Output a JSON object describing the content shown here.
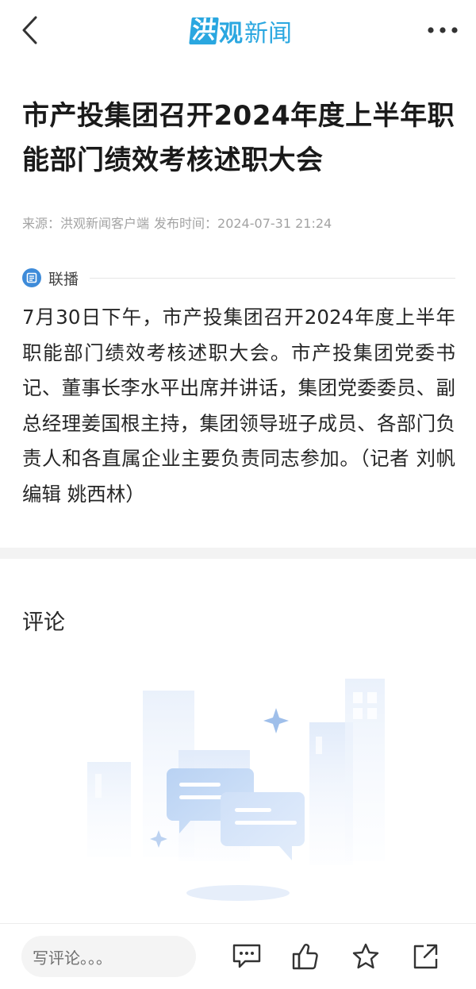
{
  "nav": {
    "logo_part1": "洪",
    "logo_part2": "观",
    "logo_part3": "新闻"
  },
  "article": {
    "title": "市产投集团召开2024年度上半年职能部门绩效考核述职大会",
    "source": "来源：洪观新闻客户端",
    "published": "发布时间：2024-07-31 21:24",
    "section_label": "联播",
    "body": "7月30日下午，市产投集团召开2024年度上半年职能部门绩效考核述职大会。市产投集团党委书记、董事长李水平出席并讲话，集团党委委员、副总经理姜国根主持，集团领导班子成员、各部门负责人和各直属企业主要负责同志参加。（记者 刘帆 编辑 姚西林）"
  },
  "comments": {
    "heading": "评论"
  },
  "bottom_bar": {
    "comment_placeholder": "写评论。。。"
  },
  "icons": {
    "back": "back-arrow-icon",
    "more": "more-icon",
    "section": "news-icon",
    "comment": "comment-icon",
    "like": "thumbs-up-icon",
    "favorite": "star-icon",
    "share": "share-icon"
  },
  "colors": {
    "brand": "#2aa7e0",
    "section_icon": "#3e8bd9",
    "meta_text": "#a3a3a3",
    "title_text": "#1a1a1a"
  }
}
